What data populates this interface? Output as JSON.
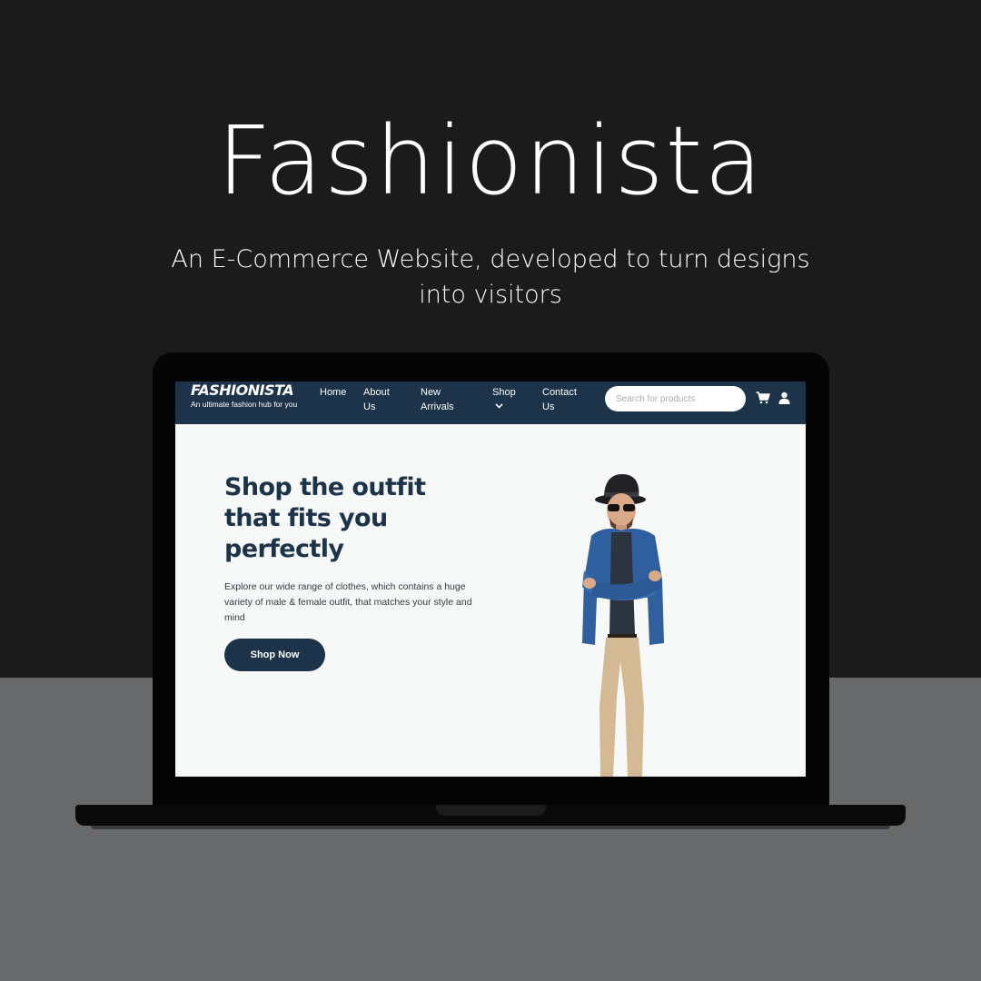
{
  "page": {
    "title": "Fashionista",
    "subtitle": "An E-Commerce Website, developed to turn designs into visitors"
  },
  "site": {
    "brand": {
      "logo": "FASHIONISTA",
      "tagline": "An ultimate fashion hub for you"
    },
    "nav": {
      "home": "Home",
      "about": "About Us",
      "new_arrivals": "New Arrivals",
      "shop": "Shop",
      "contact": "Contact Us"
    },
    "search": {
      "placeholder": "Search for products",
      "value": ""
    },
    "icons": {
      "cart": "cart-icon",
      "user": "user-icon",
      "shop_dropdown": "chevron-down-icon"
    },
    "hero": {
      "headline": "Shop the outfit that fits you perfectly",
      "description": "Explore our wide range of clothes, which contains a huge variety of male & female outfit, that matches your style and mind",
      "cta": "Shop Now"
    }
  },
  "colors": {
    "background_dark": "#1b1b1b",
    "background_gray": "#68696b",
    "navbar": "#1c3349",
    "screen_bg": "#f7f8f8",
    "text_dark": "#1c3349"
  }
}
